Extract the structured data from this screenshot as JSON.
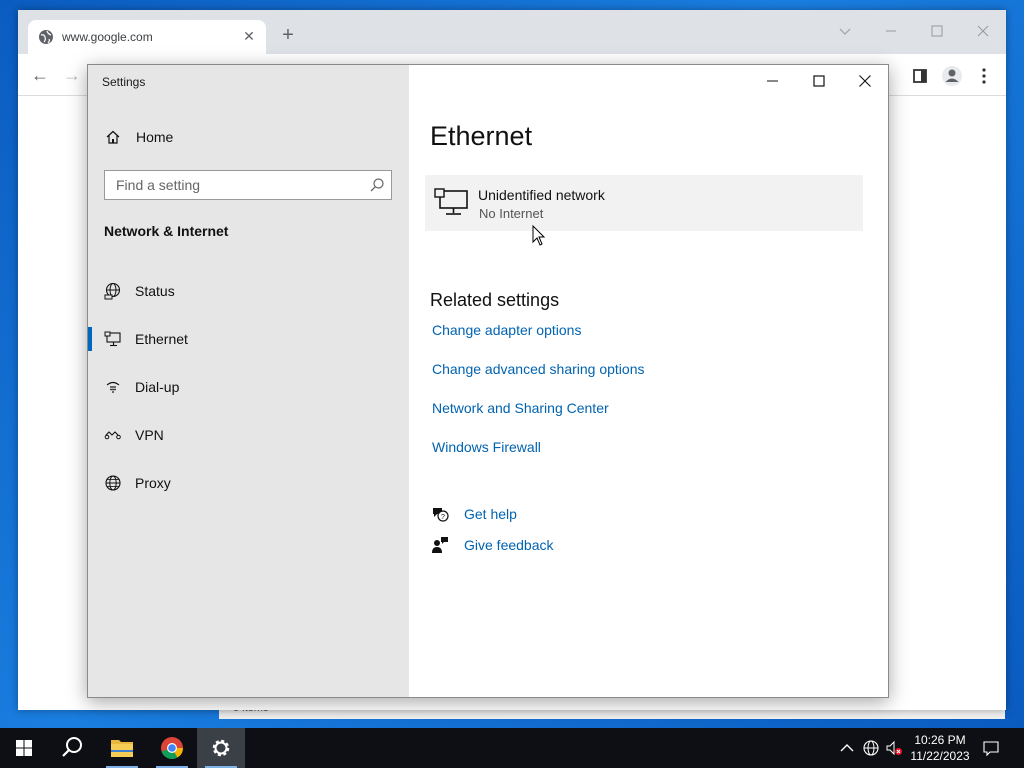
{
  "browser": {
    "tab_title": "www.google.com",
    "tab_close": "✕",
    "new_tab": "+",
    "back": "←",
    "forward": "→"
  },
  "explorer": {
    "status_text": "5 items"
  },
  "settings": {
    "window_title": "Settings",
    "home_label": "Home",
    "search_placeholder": "Find a setting",
    "section_title": "Network & Internet",
    "nav_items": [
      {
        "label": "Status",
        "icon": "globe-status-icon"
      },
      {
        "label": "Ethernet",
        "icon": "ethernet-icon"
      },
      {
        "label": "Dial-up",
        "icon": "dialup-icon"
      },
      {
        "label": "VPN",
        "icon": "vpn-icon"
      },
      {
        "label": "Proxy",
        "icon": "globe-icon"
      }
    ],
    "active_item": "Ethernet",
    "controls": {
      "minimize": "—",
      "maximize": "☐",
      "close": "✕"
    },
    "page_title": "Ethernet",
    "network": {
      "name": "Unidentified network",
      "status": "No Internet"
    },
    "related_title": "Related settings",
    "related_links": [
      "Change adapter options",
      "Change advanced sharing options",
      "Network and Sharing Center",
      "Windows Firewall"
    ],
    "help": {
      "get_help": "Get help",
      "give_feedback": "Give feedback"
    }
  },
  "taskbar": {
    "time": "10:26 PM",
    "date": "11/22/2023"
  },
  "colors": {
    "accent": "#0067c0",
    "link": "#0063b1",
    "sidebar": "#e6e6e6",
    "taskbar": "#0d0f14"
  }
}
